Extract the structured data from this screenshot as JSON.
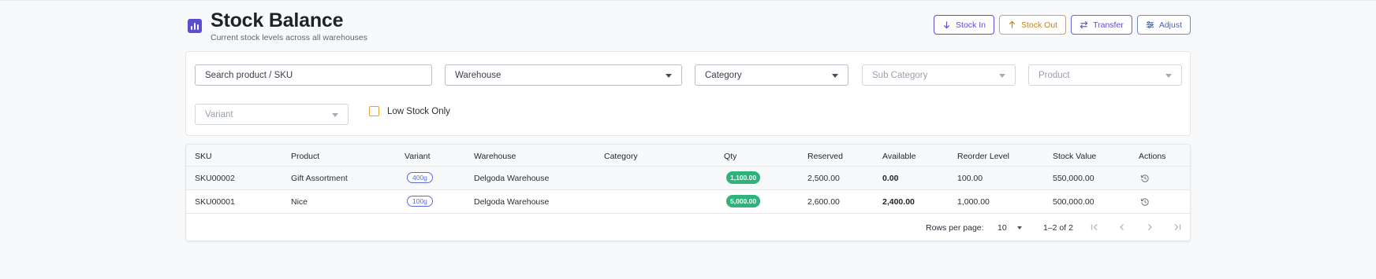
{
  "header": {
    "title": "Stock Balance",
    "subtitle": "Current stock levels across all warehouses",
    "actions": [
      {
        "label": "Stock In",
        "icon": "arrow-down-icon"
      },
      {
        "label": "Stock Out",
        "icon": "arrow-up-icon"
      },
      {
        "label": "Transfer",
        "icon": "swap-icon"
      },
      {
        "label": "Adjust",
        "icon": "sliders-icon"
      }
    ]
  },
  "filters": {
    "search_placeholder": "Search product / SKU",
    "warehouse": "Warehouse",
    "category": "Category",
    "sub_category": "Sub Category",
    "product": "Product",
    "variant": "Variant",
    "low_stock_label": "Low Stock Only"
  },
  "table": {
    "columns": [
      "SKU",
      "Product",
      "Variant",
      "Warehouse",
      "Category",
      "Qty",
      "Reserved",
      "Available",
      "Reorder Level",
      "Stock Value",
      "Actions"
    ],
    "rows": [
      {
        "sku": "SKU00002",
        "product": "Gift Assortment",
        "variant": "400g",
        "warehouse": "Delgoda Warehouse",
        "category": "",
        "qty": "1,100.00",
        "reserved": "2,500.00",
        "available": "0.00",
        "reorder_level": "100.00",
        "stock_value": "550,000.00"
      },
      {
        "sku": "SKU00001",
        "product": "Nice",
        "variant": "100g",
        "warehouse": "Delgoda Warehouse",
        "category": "",
        "qty": "5,000.00",
        "reserved": "2,600.00",
        "available": "2,400.00",
        "reorder_level": "1,000.00",
        "stock_value": "500,000.00"
      }
    ]
  },
  "pagination": {
    "rows_per_page_label": "Rows per page:",
    "rows_per_page": "10",
    "range": "1–2 of 2"
  },
  "colors": {
    "accent": "#5b4fcf",
    "stock_out": "#e3a12b",
    "qty_badge": "#2fb37a"
  }
}
